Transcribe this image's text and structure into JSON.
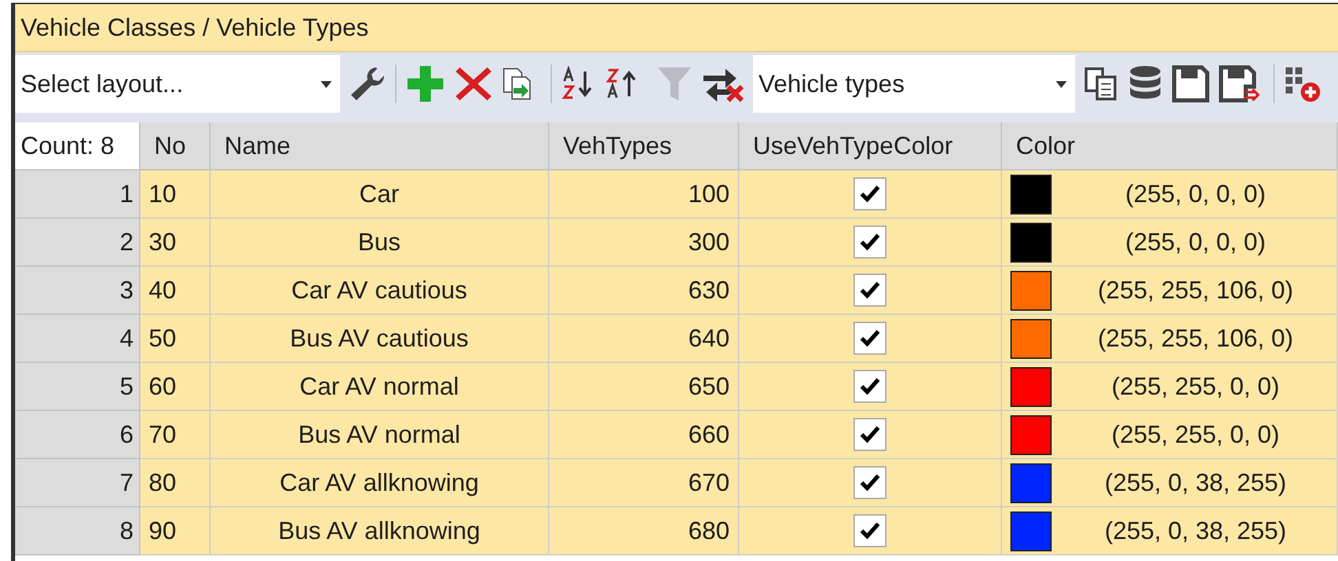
{
  "window": {
    "title": "Vehicle Classes / Vehicle Types"
  },
  "toolbar": {
    "layout_select": {
      "placeholder": "Select layout..."
    },
    "list_select": {
      "value": "Vehicle types"
    }
  },
  "table": {
    "count_label": "Count: 8",
    "columns": [
      "No",
      "Name",
      "VehTypes",
      "UseVehTypeColor",
      "Color"
    ],
    "rows": [
      {
        "index": "1",
        "no": "10",
        "name": "Car",
        "veh_types": "100",
        "use_veh_type_color": true,
        "color": "#000000",
        "color_text": "(255, 0, 0, 0)"
      },
      {
        "index": "2",
        "no": "30",
        "name": "Bus",
        "veh_types": "300",
        "use_veh_type_color": true,
        "color": "#000000",
        "color_text": "(255, 0, 0, 0)"
      },
      {
        "index": "3",
        "no": "40",
        "name": "Car AV cautious",
        "veh_types": "630",
        "use_veh_type_color": true,
        "color": "#ff6a00",
        "color_text": "(255, 255, 106, 0)"
      },
      {
        "index": "4",
        "no": "50",
        "name": "Bus AV cautious",
        "veh_types": "640",
        "use_veh_type_color": true,
        "color": "#ff6a00",
        "color_text": "(255, 255, 106, 0)"
      },
      {
        "index": "5",
        "no": "60",
        "name": "Car AV normal",
        "veh_types": "650",
        "use_veh_type_color": true,
        "color": "#ff0000",
        "color_text": "(255, 255, 0, 0)"
      },
      {
        "index": "6",
        "no": "70",
        "name": "Bus AV normal",
        "veh_types": "660",
        "use_veh_type_color": true,
        "color": "#ff0000",
        "color_text": "(255, 255, 0, 0)"
      },
      {
        "index": "7",
        "no": "80",
        "name": "Car AV allknowing",
        "veh_types": "670",
        "use_veh_type_color": true,
        "color": "#0026ff",
        "color_text": "(255, 0, 38, 255)"
      },
      {
        "index": "8",
        "no": "90",
        "name": "Bus AV allknowing",
        "veh_types": "680",
        "use_veh_type_color": true,
        "color": "#0026ff",
        "color_text": "(255, 0, 38, 255)"
      }
    ]
  }
}
